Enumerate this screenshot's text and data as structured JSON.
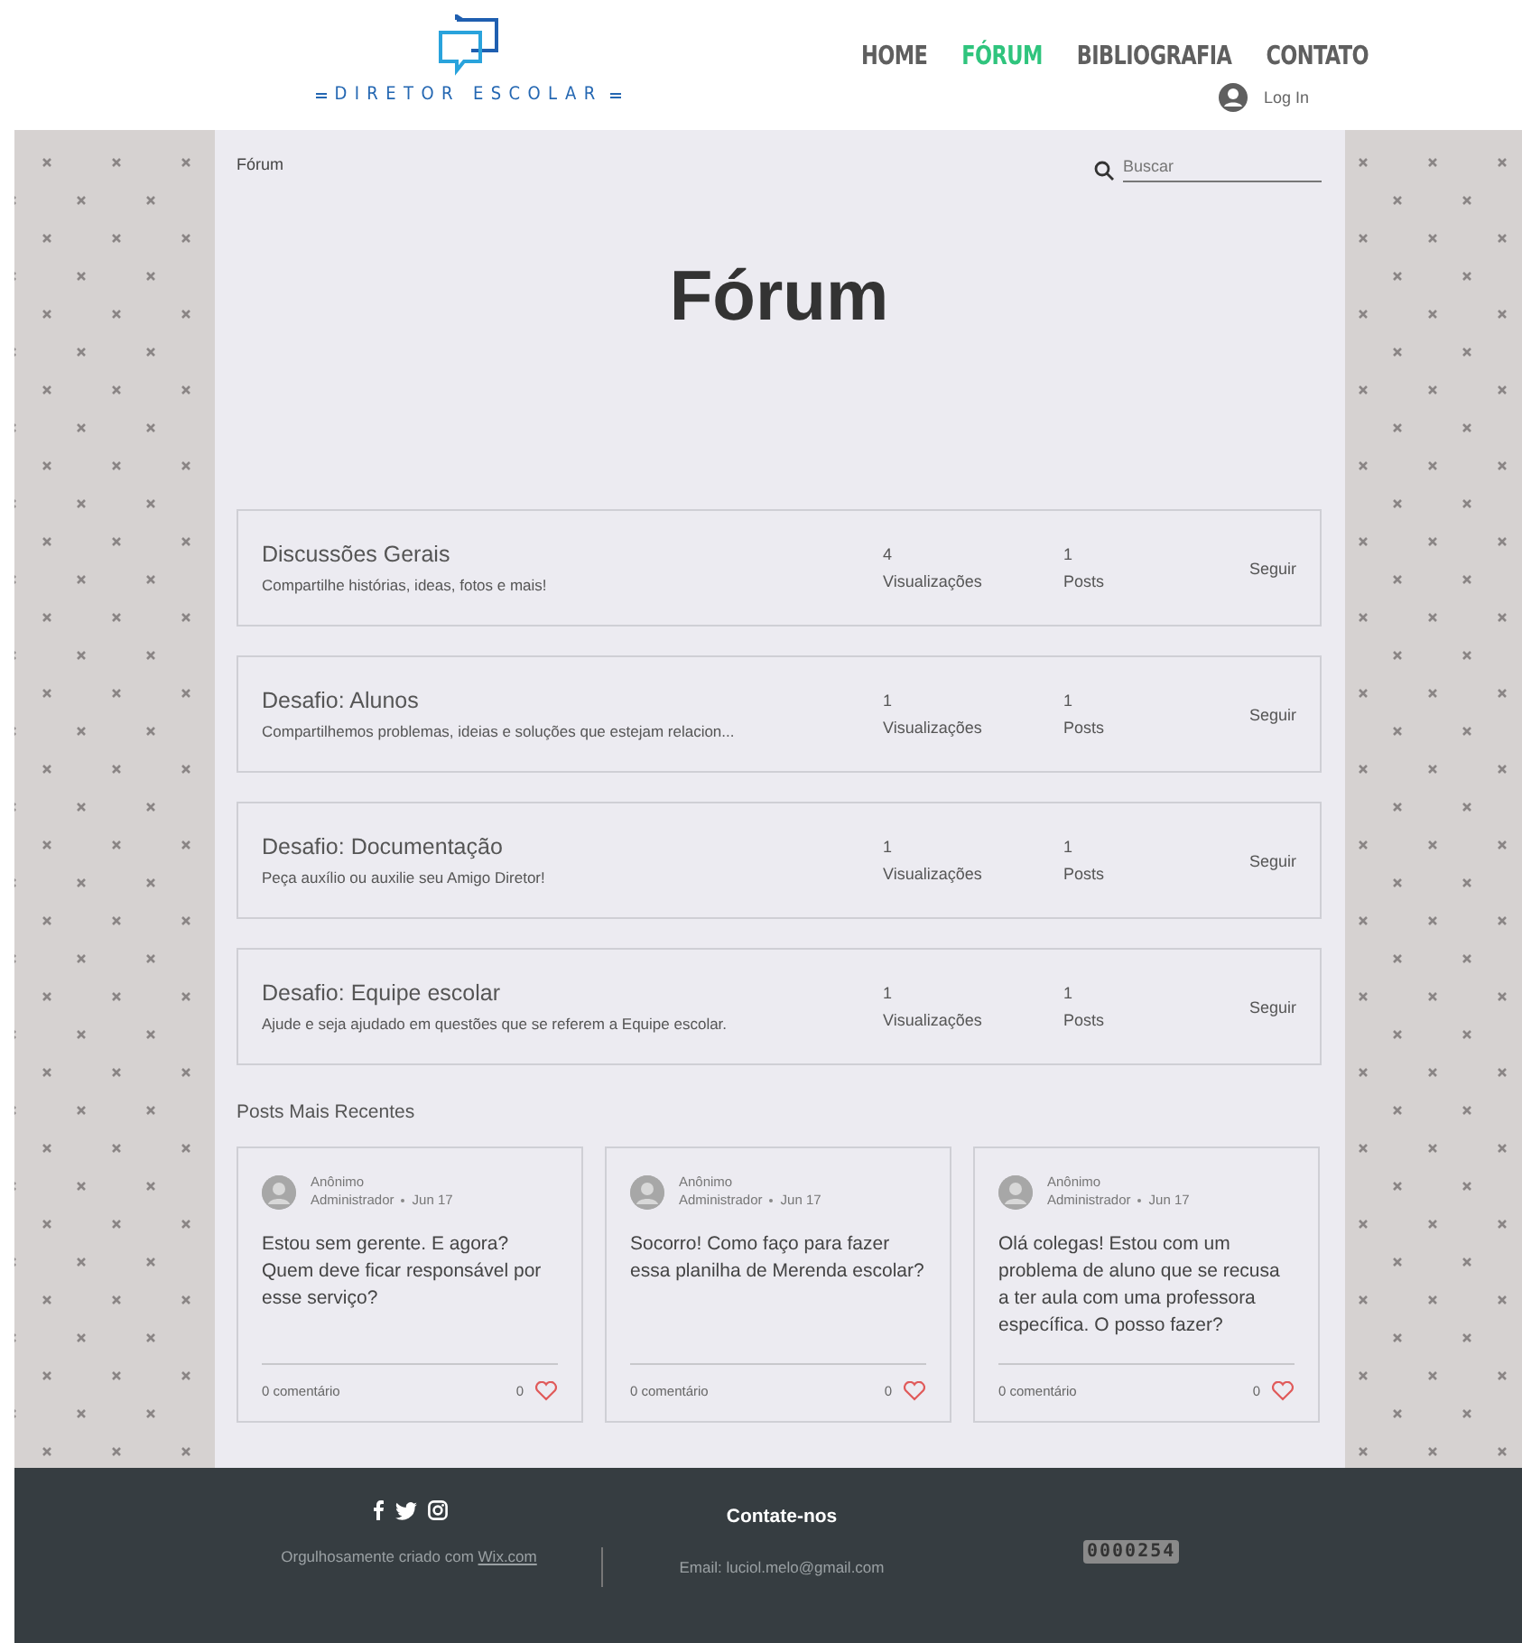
{
  "header": {
    "logo_text": "DIRETOR ESCOLAR",
    "nav": [
      {
        "label": "HOME",
        "selected": false
      },
      {
        "label": "FÓRUM",
        "selected": true
      },
      {
        "label": "BIBLIOGRAFIA",
        "selected": false
      },
      {
        "label": "CONTATO",
        "selected": false
      }
    ],
    "login": "Log In"
  },
  "breadcrumb": "Fórum",
  "search": {
    "placeholder": "Buscar"
  },
  "title": "Fórum",
  "categories": [
    {
      "name": "Discussões Gerais",
      "description": "Compartilhe histórias, ideas, fotos e mais!",
      "views": "4",
      "views_label": "Visualizações",
      "posts": "1",
      "posts_label": "Posts",
      "follow": "Seguir"
    },
    {
      "name": "Desafio: Alunos",
      "description": "Compartilhemos problemas, ideias e soluções que estejam relacion...",
      "views": "1",
      "views_label": "Visualizações",
      "posts": "1",
      "posts_label": "Posts",
      "follow": "Seguir"
    },
    {
      "name": "Desafio: Documentação",
      "description": "Peça auxílio ou auxilie seu Amigo Diretor!",
      "views": "1",
      "views_label": "Visualizações",
      "posts": "1",
      "posts_label": "Posts",
      "follow": "Seguir"
    },
    {
      "name": "Desafio: Equipe escolar",
      "description": "Ajude e seja ajudado em questões que se referem a Equipe escolar.",
      "views": "1",
      "views_label": "Visualizações",
      "posts": "1",
      "posts_label": "Posts",
      "follow": "Seguir"
    }
  ],
  "recent_heading": "Posts Mais Recentes",
  "posts": [
    {
      "author": "Anônimo",
      "role": "Administrador",
      "date": "Jun 17",
      "text": "Estou sem gerente. E agora? Quem deve ficar responsável por esse serviço?",
      "comments": "0 comentário",
      "likes": "0"
    },
    {
      "author": "Anônimo",
      "role": "Administrador",
      "date": "Jun 17",
      "text": "Socorro! Como faço para fazer essa planilha de Merenda escolar?",
      "comments": "0 comentário",
      "likes": "0"
    },
    {
      "author": "Anônimo",
      "role": "Administrador",
      "date": "Jun 17",
      "text": "Olá colegas! Estou com um problema de aluno que se recusa a ter aula com uma professora específica. O posso fazer?",
      "comments": "0 comentário",
      "likes": "0"
    }
  ],
  "footer": {
    "credit": "Orgulhosamente criado com",
    "credit_link": "Wix.com",
    "contact_heading": "Contate-nos",
    "email": "Email: luciol.melo@gmail.com",
    "counter": "0000254"
  }
}
